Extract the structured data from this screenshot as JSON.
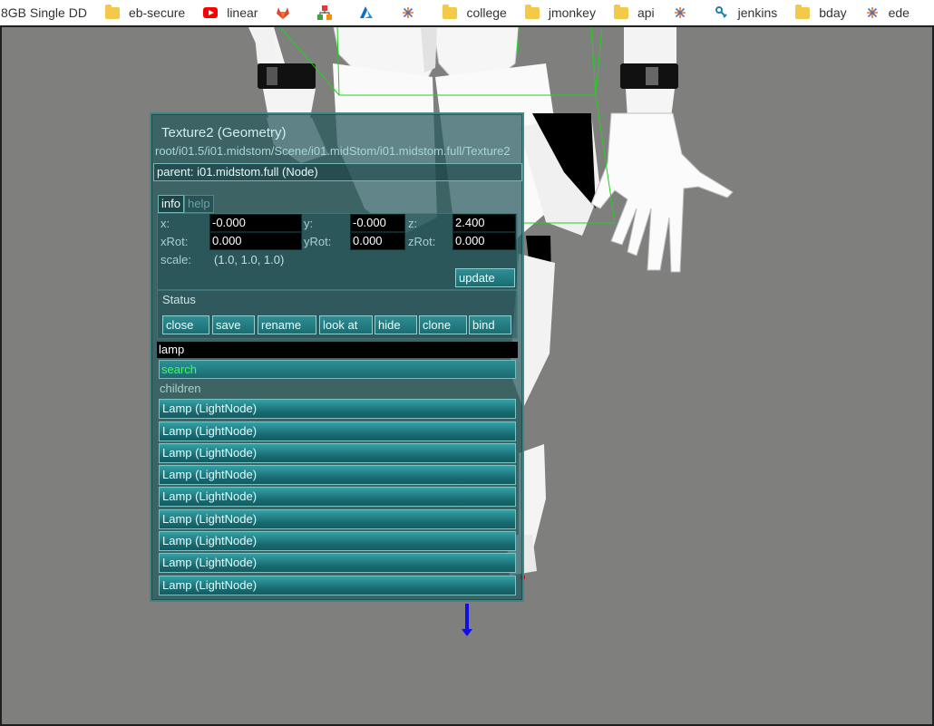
{
  "bookmarks": [
    {
      "label": "8GB Single DD",
      "icon": "none"
    },
    {
      "label": "eb-secure",
      "icon": "folder-icon"
    },
    {
      "label": "linear",
      "icon": "youtube-icon"
    },
    {
      "label": "",
      "icon": "gitlab-icon"
    },
    {
      "label": "",
      "icon": "git-graph-icon"
    },
    {
      "label": "",
      "icon": "azure-icon"
    },
    {
      "label": "",
      "icon": "tableau-icon"
    },
    {
      "label": "college",
      "icon": "folder-icon"
    },
    {
      "label": "jmonkey",
      "icon": "folder-icon"
    },
    {
      "label": "api",
      "icon": "folder-icon"
    },
    {
      "label": "",
      "icon": "tableau-icon"
    },
    {
      "label": "jenkins",
      "icon": "jenkins-icon"
    },
    {
      "label": "bday",
      "icon": "folder-icon"
    },
    {
      "label": "ede",
      "icon": "tableau-icon"
    }
  ],
  "panel": {
    "title": "Texture2 (Geometry)",
    "path": "root/i01.5/i01.midstom/Scene/i01.midStom/i01.midstom.full/Texture2",
    "parent": "parent: i01.midstom.full (Node)",
    "tabs": {
      "info": "info",
      "help": "help"
    },
    "fields": {
      "x_label": "x:",
      "x": "-0.000",
      "y_label": "y:",
      "y": "-0.000",
      "z_label": "z:",
      "z": "2.400",
      "xrot_label": "xRot:",
      "xrot": "0.000",
      "yrot_label": "yRot:",
      "yrot": "0.000",
      "zrot_label": "zRot:",
      "zrot": "0.000",
      "scale_label": "scale:",
      "scale": "(1.0, 1.0, 1.0)"
    },
    "update_label": "update",
    "status_label": "Status",
    "actions": [
      "close",
      "save",
      "rename",
      "look at",
      "hide",
      "clone",
      "bind"
    ],
    "filter_text": "lamp",
    "search_label": "search",
    "children_label": "children",
    "children": [
      "Lamp (LightNode)",
      "Lamp (LightNode)",
      "Lamp (LightNode)",
      "Lamp (LightNode)",
      "Lamp (LightNode)",
      "Lamp (LightNode)",
      "Lamp (LightNode)",
      "Lamp (LightNode)",
      "Lamp (LightNode)"
    ]
  },
  "colors": {
    "viewport_bg": "#7f807e",
    "bounding_box": "#1fd21f",
    "axis": "#1010e6",
    "search_text": "#3dff4e"
  }
}
